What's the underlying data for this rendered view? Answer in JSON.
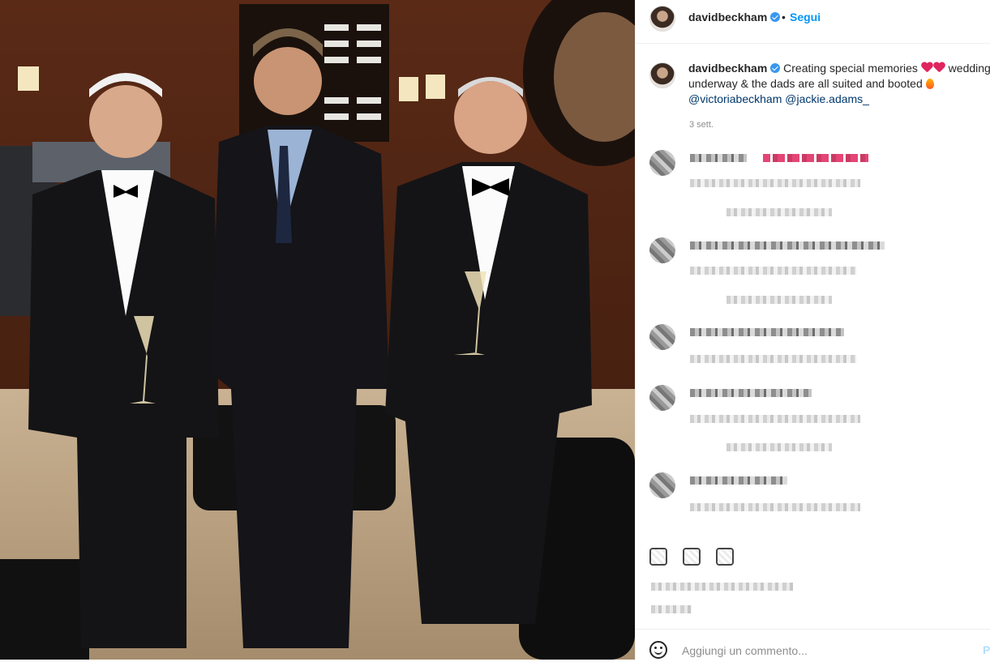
{
  "post": {
    "author": "davidbeckham",
    "separator": "•",
    "follow_label": "Segui",
    "caption_author": "davidbeckham",
    "caption_text_1": "Creating special memories",
    "caption_text_2": "wedding underway & the dads are all suited and booted",
    "mention_1": "@victoriabeckham",
    "mention_2": "@jackie.adams_",
    "time_ago": "3 sett."
  },
  "footer": {
    "comment_placeholder": "Aggiungi un commento...",
    "publish_label": "P"
  },
  "colors": {
    "accent": "#0095f6",
    "verified": "#3897f0",
    "heart": "#e0245e",
    "link": "#00376b"
  },
  "icons": [
    "verified-badge-icon",
    "heart-emoji-icon",
    "fire-emoji-icon",
    "like-icon",
    "comment-icon",
    "share-icon",
    "bookmark-icon",
    "emoji-icon"
  ]
}
